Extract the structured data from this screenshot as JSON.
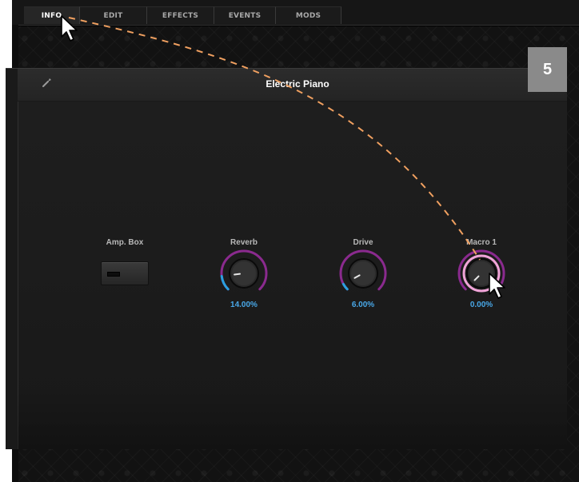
{
  "tabs": [
    {
      "label": "INFO",
      "active": true
    },
    {
      "label": "EDIT",
      "active": false
    },
    {
      "label": "EFFECTS",
      "active": false
    },
    {
      "label": "EVENTS",
      "active": false
    },
    {
      "label": "MODS",
      "active": false
    }
  ],
  "step_badge": "5",
  "panel": {
    "title": "Electric Piano",
    "settings_icon": "wrench-icon"
  },
  "controls": {
    "amp_box": {
      "label": "Amp. Box",
      "type": "switch"
    },
    "reverb": {
      "label": "Reverb",
      "value": "14.00%",
      "level": 0.14
    },
    "drive": {
      "label": "Drive",
      "value": "6.00%",
      "level": 0.06
    },
    "macro1": {
      "label": "Macro 1",
      "value": "0.00%",
      "level": 0.0,
      "highlighted": true
    }
  },
  "colors": {
    "value_text": "#49a8e8",
    "knob_ring": "#8a2a8e",
    "knob_fill": "#2aa0e0",
    "highlight": "#f0a4d8",
    "drag_path": "#f0a060",
    "badge": "#8a8a8a"
  },
  "annotation": {
    "description_icon": "mouse-pointer-icon",
    "path_icon": "dashed-drag-path"
  }
}
